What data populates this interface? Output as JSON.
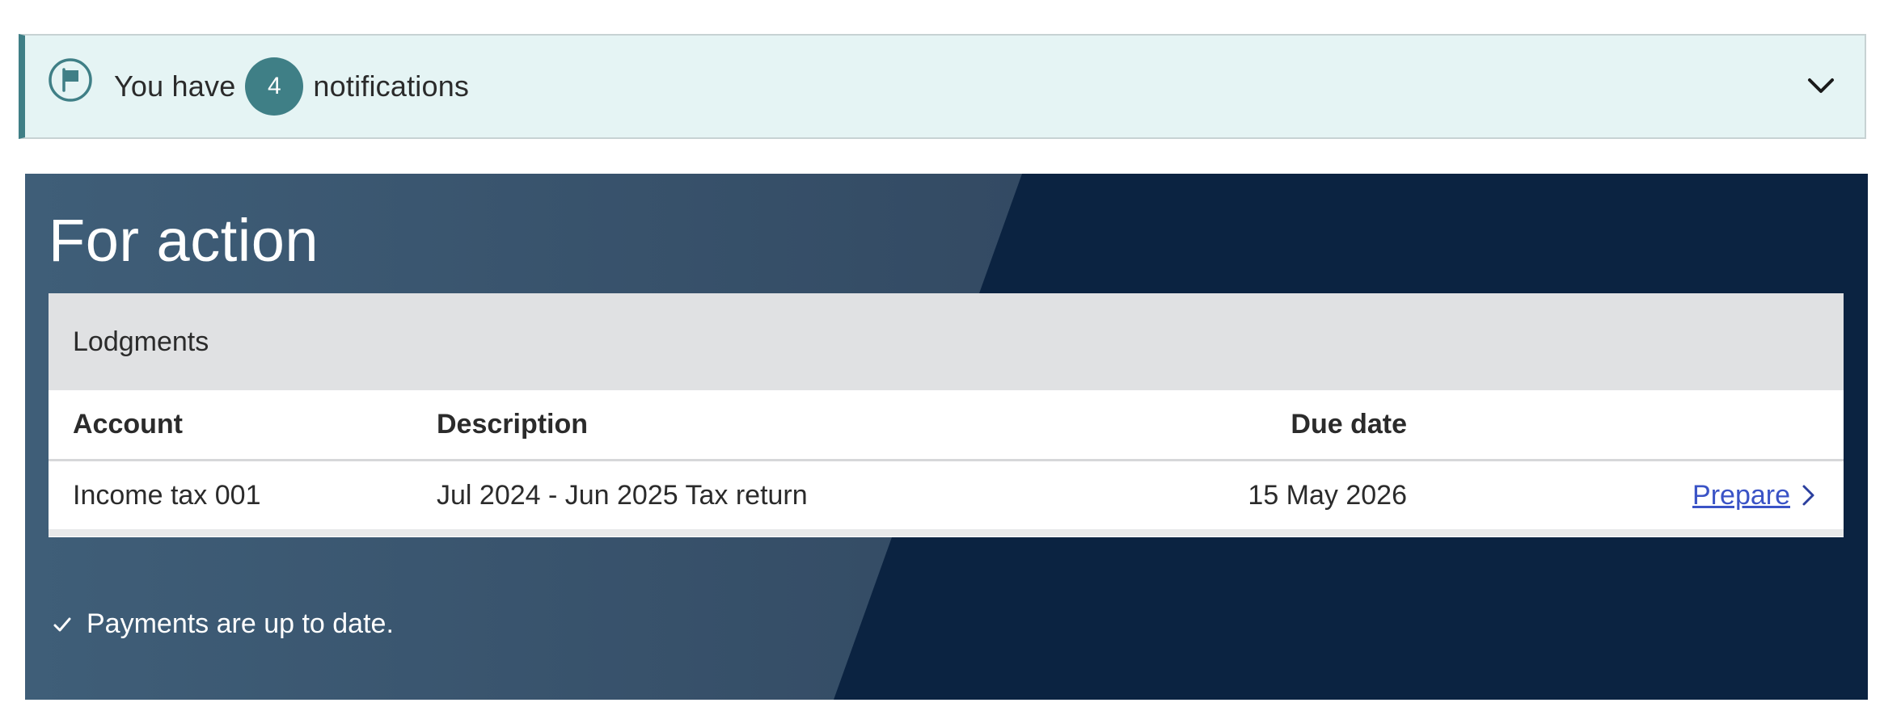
{
  "notifications": {
    "prefix": "You have",
    "count": "4",
    "suffix": "notifications"
  },
  "for_action": {
    "title": "For action",
    "section_title": "Lodgments",
    "columns": {
      "account": "Account",
      "description": "Description",
      "due_date": "Due date"
    },
    "rows": [
      {
        "account": "Income tax 001",
        "description": "Jul 2024 - Jun 2025 Tax return",
        "due_date": "15 May 2026",
        "action": "Prepare"
      }
    ],
    "payments_status": "Payments are up to date."
  },
  "colors": {
    "banner_bg": "#e5f4f4",
    "accent_teal": "#3f7f86",
    "panel_dark": "#0b2341",
    "link_blue": "#3a53c6"
  },
  "icons": {
    "flag": "flag-icon",
    "toggle": "chevron-down-icon",
    "prepare": "chevron-right-icon",
    "status": "check-icon"
  }
}
